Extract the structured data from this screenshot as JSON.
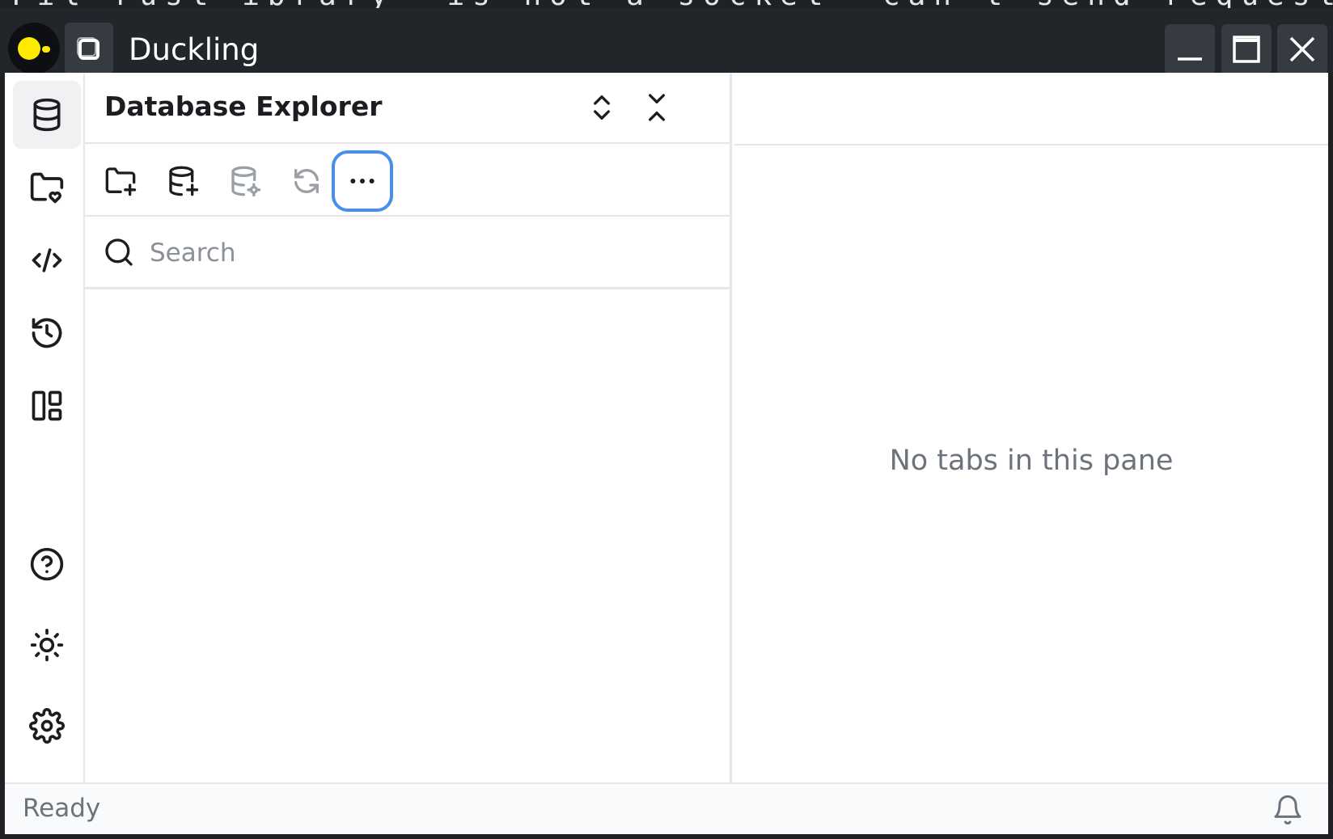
{
  "background_terminal": {
    "text": "Fil rust ibrary 'is not a socket' can't send request to"
  },
  "window": {
    "title": "Duckling",
    "app_icon": "duck-logo-icon",
    "controls": {
      "minimize": "minimize-icon",
      "maximize": "maximize-icon",
      "close": "close-icon"
    }
  },
  "activity_bar": {
    "top_items": [
      {
        "id": "database",
        "icon": "database-icon",
        "active": true
      },
      {
        "id": "saved",
        "icon": "folder-heart-icon",
        "active": false
      },
      {
        "id": "sql",
        "icon": "code-icon",
        "active": false
      },
      {
        "id": "history",
        "icon": "history-icon",
        "active": false
      },
      {
        "id": "layout",
        "icon": "layout-dashboard-icon",
        "active": false
      }
    ],
    "bottom_items": [
      {
        "id": "help",
        "icon": "help-circle-icon"
      },
      {
        "id": "theme",
        "icon": "sun-icon"
      },
      {
        "id": "settings",
        "icon": "gear-icon"
      }
    ]
  },
  "explorer": {
    "title": "Database Explorer",
    "header_actions": [
      "expand-all-icon",
      "collapse-all-icon"
    ],
    "toolbar": [
      {
        "id": "new-folder",
        "icon": "folder-plus-icon",
        "enabled": true
      },
      {
        "id": "add-database",
        "icon": "database-plus-icon",
        "enabled": true
      },
      {
        "id": "database-settings",
        "icon": "database-gear-icon",
        "enabled": false
      },
      {
        "id": "refresh",
        "icon": "refresh-icon",
        "enabled": false
      },
      {
        "id": "more",
        "icon": "more-horizontal-icon",
        "enabled": true,
        "focused": true
      }
    ],
    "search": {
      "placeholder": "Search",
      "value": ""
    }
  },
  "editor": {
    "empty_message": "No tabs in this pane"
  },
  "statusbar": {
    "status": "Ready",
    "notifications_icon": "bell-icon"
  },
  "colors": {
    "titlebar": "#22262b",
    "focus_ring": "#4a90e2",
    "logo_yellow": "#ffeb00",
    "muted_text": "#6c737c",
    "border": "#e4e6e9"
  }
}
